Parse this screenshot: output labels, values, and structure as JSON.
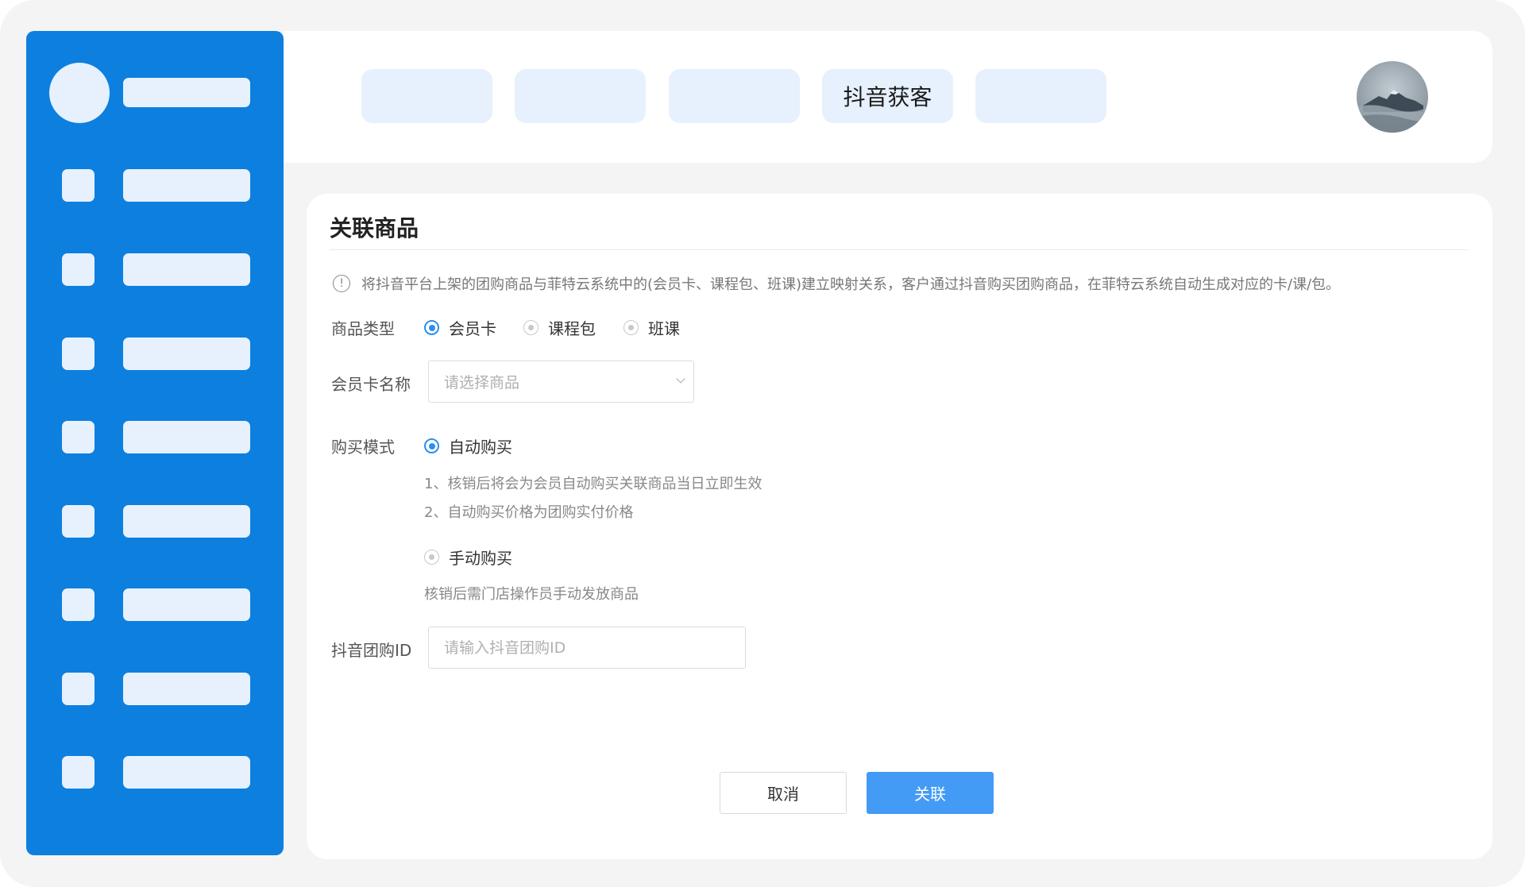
{
  "header": {
    "tabs": [
      {
        "label": ""
      },
      {
        "label": ""
      },
      {
        "label": ""
      },
      {
        "label": "抖音获客"
      },
      {
        "label": ""
      }
    ]
  },
  "form": {
    "title": "关联商品",
    "notice": "将抖音平台上架的团购商品与菲特云系统中的(会员卡、课程包、班课)建立映射关系，客户通过抖音购买团购商品，在菲特云系统自动生成对应的卡/课/包。",
    "product_type": {
      "label": "商品类型",
      "options": [
        "会员卡",
        "课程包",
        "班课"
      ],
      "selected": "会员卡"
    },
    "card_name": {
      "label": "会员卡名称",
      "placeholder": "请选择商品"
    },
    "purchase_mode": {
      "label": "购买模式",
      "auto": {
        "label": "自动购买",
        "hints": [
          "1、核销后将会为会员自动购买关联商品当日立即生效",
          "2、自动购买价格为团购实付价格"
        ]
      },
      "manual": {
        "label": "手动购买",
        "hint": "核销后需门店操作员手动发放商品"
      },
      "selected": "自动购买"
    },
    "groupbuy_id": {
      "label": "抖音团购ID",
      "placeholder": "请输入抖音团购ID"
    },
    "cancel_label": "取消",
    "confirm_label": "关联"
  },
  "colors": {
    "sidebar": "#0d7fdf",
    "accent": "#2a8ff0",
    "primary_button": "#449bf5",
    "placeholder_block": "#e6f1fd"
  }
}
